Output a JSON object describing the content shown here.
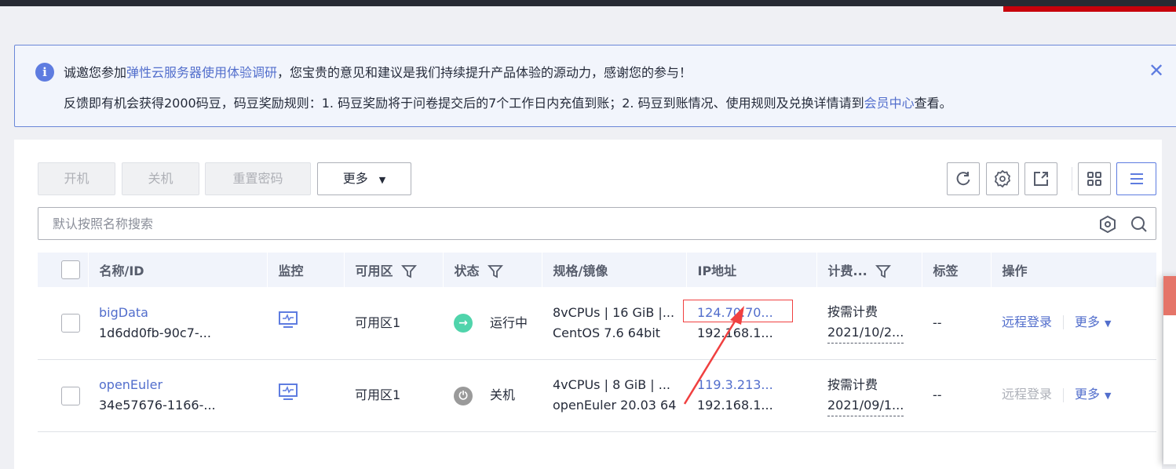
{
  "notice": {
    "line1_pre": "诚邀您参加",
    "line1_link": "弹性云服务器使用体验调研",
    "line1_post": "，您宝贵的意见和建议是我们持续提升产品体验的源动力，感谢您的参与！",
    "line2_pre": "反馈即有机会获得2000码豆，码豆奖励规则：1. 码豆奖励将于问卷提交后的7个工作日内充值到账；2. 码豆到账情况、使用规则及兑换详情请到",
    "line2_link": "会员中心",
    "line2_post": "查看。",
    "close": "✕"
  },
  "toolbar": {
    "start": "开机",
    "stop": "关机",
    "reset_password": "重置密码",
    "more": "更多"
  },
  "search": {
    "placeholder": "默认按照名称搜索"
  },
  "table": {
    "headers": [
      "名称/ID",
      "监控",
      "可用区",
      "状态",
      "规格/镜像",
      "IP地址",
      "计费...",
      "标签",
      "操作"
    ],
    "rows": [
      {
        "name": "bigData",
        "id": "1d6dd0fb-90c7-...",
        "zone": "可用区1",
        "status": "运行中",
        "spec": "8vCPUs | 16 GiB |...",
        "image": "CentOS 7.6 64bit",
        "ip_public": "124.70.70...",
        "ip_private": "192.168.1...",
        "billing": "按需计费",
        "date": "2021/10/2...",
        "tags": "--",
        "remote": "远程登录",
        "more": "更多"
      },
      {
        "name": "openEuler",
        "id": "34e57676-1166-...",
        "zone": "可用区1",
        "status": "关机",
        "spec": "4vCPUs | 8 GiB | ...",
        "image": "openEuler 20.03 64",
        "ip_public": "119.3.213...",
        "ip_private": "192.168.1...",
        "billing": "按需计费",
        "date": "2021/09/1...",
        "tags": "--",
        "remote": "远程登录",
        "more": "更多"
      }
    ]
  },
  "colors": {
    "accent": "#5e7ce0",
    "running": "#50d4ab",
    "stopped": "#9a9a9a",
    "annotation": "#f04040"
  }
}
